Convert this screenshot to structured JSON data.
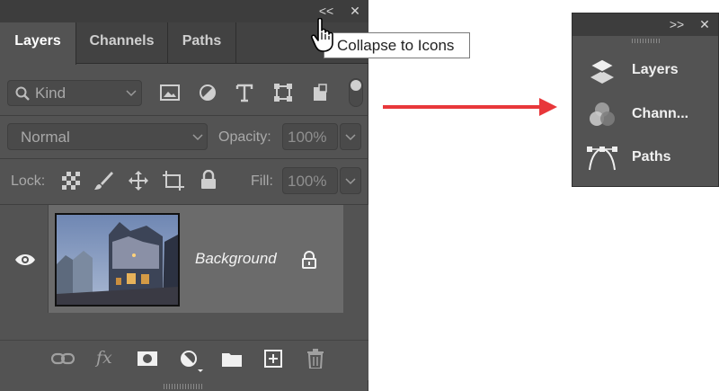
{
  "expanded_panel": {
    "titlebar": {
      "collapse_icon_label": "<<",
      "close_icon_label": "✕"
    },
    "tabs": [
      {
        "label": "Layers",
        "active": true
      },
      {
        "label": "Channels",
        "active": false
      },
      {
        "label": "Paths",
        "active": false
      }
    ],
    "filter": {
      "kind_label": "Kind"
    },
    "blend": {
      "mode": "Normal",
      "opacity_label": "Opacity:",
      "opacity_value": "100%"
    },
    "lock": {
      "label": "Lock:",
      "fill_label": "Fill:",
      "fill_value": "100%"
    },
    "layer": {
      "name": "Background",
      "visible": true,
      "locked": true
    },
    "bottom_icons": [
      "link-icon",
      "fx-icon",
      "mask-icon",
      "adjustment-icon",
      "folder-icon",
      "new-layer-icon",
      "trash-icon"
    ],
    "fx_label": "fx"
  },
  "tooltip": {
    "text": "Collapse to Icons"
  },
  "arrow_color": "#e8373a",
  "collapsed_panel": {
    "expand_icon_label": ">>",
    "close_icon_label": "✕",
    "items": [
      {
        "label": "Layers",
        "icon": "layers-icon"
      },
      {
        "label": "Chann...",
        "icon": "channels-icon"
      },
      {
        "label": "Paths",
        "icon": "paths-icon"
      }
    ]
  }
}
